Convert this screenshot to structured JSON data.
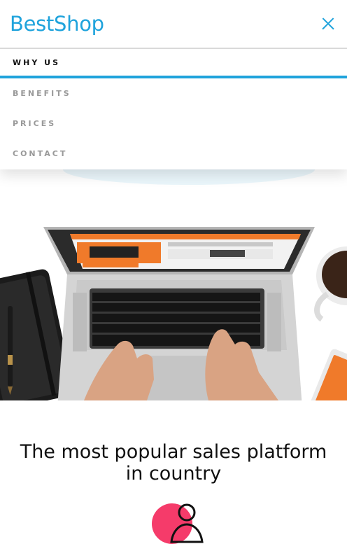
{
  "header": {
    "logo": "BestShop",
    "close_icon": "close-icon"
  },
  "menu": {
    "items": [
      {
        "label": "WHY US",
        "active": true
      },
      {
        "label": "BENEFITS",
        "active": false
      },
      {
        "label": "PRICES",
        "active": false
      },
      {
        "label": "CONTACT",
        "active": false
      }
    ]
  },
  "hero": {
    "image": "laptop-desk-photo"
  },
  "main": {
    "headline": "The most popular sales platform in country",
    "feature_icon": "user-icon"
  },
  "colors": {
    "brand": "#1fa3dc",
    "accent": "#f53b6a",
    "text": "#111111",
    "muted": "#999999"
  }
}
